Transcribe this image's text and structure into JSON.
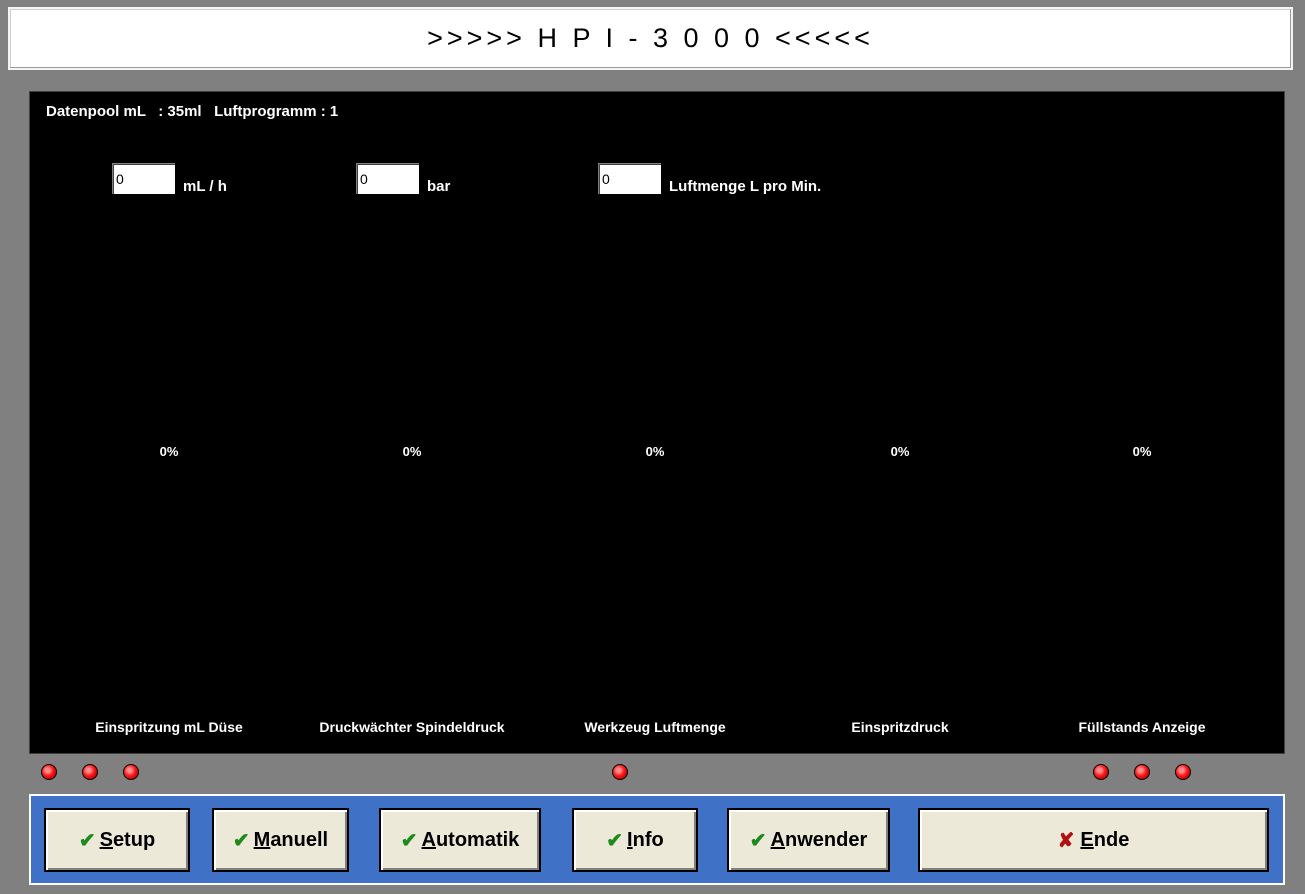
{
  "title": ">>>>> H P I - 3 0 0 0 <<<<<",
  "info_line": "Datenpool mL   : 35ml   Luftprogramm : 1",
  "inputs": [
    {
      "value": "0",
      "unit": "mL / h"
    },
    {
      "value": "0",
      "unit": "bar"
    },
    {
      "value": "0",
      "unit": "Luftmenge L pro Min."
    }
  ],
  "channels": [
    {
      "percent": "0%",
      "label": "Einspritzung mL Düse"
    },
    {
      "percent": "0%",
      "label": "Druckwächter Spindeldruck"
    },
    {
      "percent": "0%",
      "label": "Werkzeug Luftmenge"
    },
    {
      "percent": "0%",
      "label": "Einspritzdruck"
    },
    {
      "percent": "0%",
      "label": "Füllstands Anzeige"
    }
  ],
  "leds": {
    "color": "#ff1a1a",
    "state": "red"
  },
  "buttons": {
    "setup": {
      "first": "S",
      "rest": "etup",
      "icon": "check-icon"
    },
    "manuell": {
      "first": "M",
      "rest": "anuell",
      "icon": "check-icon"
    },
    "automatik": {
      "first": "A",
      "rest": "utomatik",
      "icon": "check-icon"
    },
    "info": {
      "first": "I",
      "rest": "nfo",
      "icon": "check-icon"
    },
    "anwender": {
      "first": "A",
      "rest": "nwender",
      "icon": "check-icon"
    },
    "ende": {
      "first": "E",
      "rest": "nde",
      "icon": "x-icon"
    }
  },
  "colors": {
    "panel": "#000000",
    "frame": "#808080",
    "button_bar": "#3f72c7",
    "button_face": "#ece9d8"
  }
}
